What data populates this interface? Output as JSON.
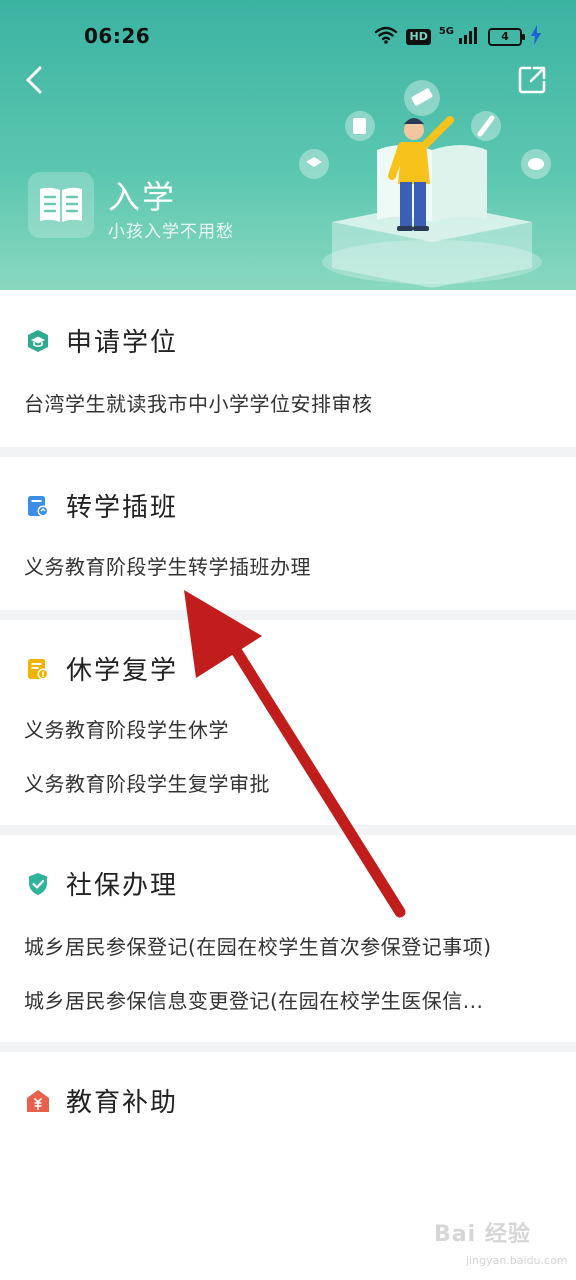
{
  "status_bar": {
    "time": "06:26",
    "hd": "HD",
    "network": "5G",
    "battery": "4"
  },
  "header": {
    "title": "入学",
    "subtitle": "小孩入学不用愁",
    "back_icon": "chevron-left-icon",
    "share_icon": "share-icon",
    "bg_color": "#3bb3a2"
  },
  "sections": [
    {
      "title": "申请学位",
      "icon": "graduation-cap-icon",
      "icon_color": "#2fa98f",
      "items": [
        "台湾学生就读我市中小学学位安排审核"
      ]
    },
    {
      "title": "转学插班",
      "icon": "transfer-doc-icon",
      "icon_color": "#3a8ee6",
      "items": [
        "义务教育阶段学生转学插班办理"
      ]
    },
    {
      "title": "休学复学",
      "icon": "suspend-doc-icon",
      "icon_color": "#f2b300",
      "items": [
        "义务教育阶段学生休学",
        "义务教育阶段学生复学审批"
      ]
    },
    {
      "title": "社保办理",
      "icon": "shield-check-icon",
      "icon_color": "#2fb39a",
      "items": [
        "城乡居民参保登记(在园在校学生首次参保登记事项)",
        "城乡居民参保信息变更登记(在园在校学生医保信..."
      ]
    },
    {
      "title": "教育补助",
      "icon": "subsidy-house-icon",
      "icon_color": "#e8604c",
      "items": []
    }
  ],
  "watermark": {
    "text": "Bai 经验",
    "sub": "jingyan.baidu.com"
  }
}
